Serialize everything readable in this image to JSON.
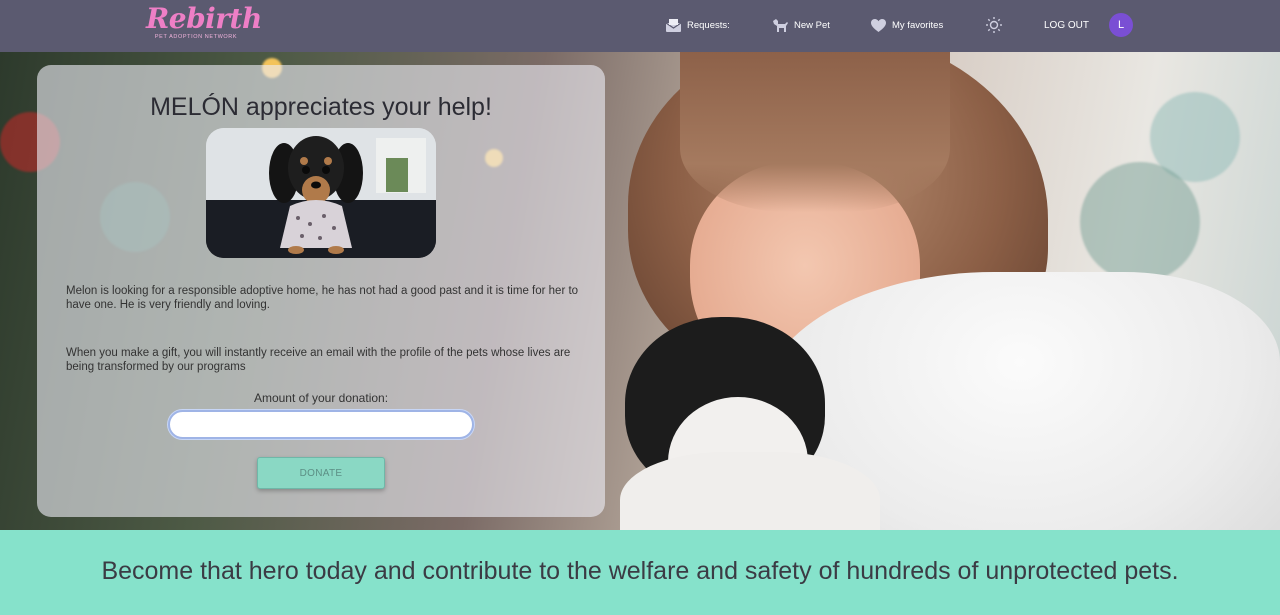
{
  "brand": {
    "name": "Rebirth",
    "tagline": "PET ADOPTION NETWORK",
    "color": "#ee7fc6"
  },
  "nav": {
    "requests_label": "Requests:",
    "new_pet_label": "New Pet",
    "favorites_label": "My favorites",
    "theme_icon": "sun-icon",
    "logout_label": "LOG OUT",
    "avatar_initial": "L",
    "background": "#5b5a70"
  },
  "donation_card": {
    "title": "MELÓN appreciates your help!",
    "photo_icon": "dachshund-puppy-photo",
    "description": "Melon is looking for a responsible adoptive home, he has not had a good past and it is time for her to have one. He is very friendly and loving.",
    "gift_info": "When you make a gift, you will instantly receive an email with the profile of the pets whose lives are being transformed by our programs",
    "amount_label": "Amount of your donation:",
    "amount_value": "",
    "donate_label": "DONATE",
    "button_color": "#8ad8c4"
  },
  "banner": {
    "text": "Become that hero today and contribute to the welfare and safety of hundreds of unprotected pets.",
    "background": "#86e2cb"
  }
}
